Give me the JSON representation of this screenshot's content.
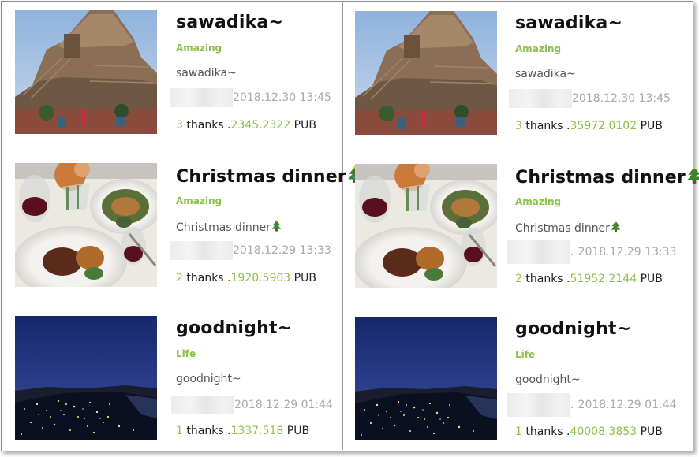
{
  "columns": [
    {
      "posts": [
        {
          "title": "sawadika~",
          "category": "Amazing",
          "body": "sawadika~",
          "date": "2018.12.30 13:45",
          "dot": "",
          "thanks_count": "3",
          "thanks_label": "thanks",
          "amount_prefix": ".",
          "amount": "2345.2322",
          "currency": "PUB",
          "image": "temple-photo",
          "has_tree": false
        },
        {
          "title": "Christmas dinner",
          "category": "Amazing",
          "body": "Christmas dinner",
          "date": "2018.12.29 13:33",
          "dot": "",
          "thanks_count": "2",
          "thanks_label": "thanks",
          "amount_prefix": ".",
          "amount": "1920.5903",
          "currency": "PUB",
          "image": "dinner-photo",
          "has_tree": true
        },
        {
          "title": "goodnight~",
          "category": "Life",
          "body": "goodnight~",
          "date": "2018.12.29 01:44",
          "dot": "",
          "thanks_count": "1",
          "thanks_label": "thanks",
          "amount_prefix": ".",
          "amount": "1337.518",
          "currency": "PUB",
          "image": "city-night-photo",
          "has_tree": false
        }
      ]
    },
    {
      "posts": [
        {
          "title": "sawadika~",
          "category": "Amazing",
          "body": "sawadika~",
          "date": "2018.12.30 13:45",
          "dot": "",
          "thanks_count": "3",
          "thanks_label": "thanks",
          "amount_prefix": ".",
          "amount": "35972.0102",
          "currency": "PUB",
          "image": "temple-photo",
          "has_tree": false
        },
        {
          "title": "Christmas dinner",
          "category": "Amazing",
          "body": "Christmas dinner",
          "date": "2018.12.29 13:33",
          "dot": ".",
          "thanks_count": "2",
          "thanks_label": "thanks",
          "amount_prefix": ".",
          "amount": "51952.2144",
          "currency": "PUB",
          "image": "dinner-photo",
          "has_tree": true
        },
        {
          "title": "goodnight~",
          "category": "Life",
          "body": "goodnight~",
          "date": "2018.12.29 01:44",
          "dot": ".",
          "thanks_count": "1",
          "thanks_label": "thanks",
          "amount_prefix": ".",
          "amount": "40008.3853",
          "currency": "PUB",
          "image": "city-night-photo",
          "has_tree": false
        }
      ]
    }
  ],
  "colors": {
    "accent": "#8fc04a",
    "title": "#111111",
    "date": "#a8a8a8",
    "border": "#8a8a8a"
  }
}
